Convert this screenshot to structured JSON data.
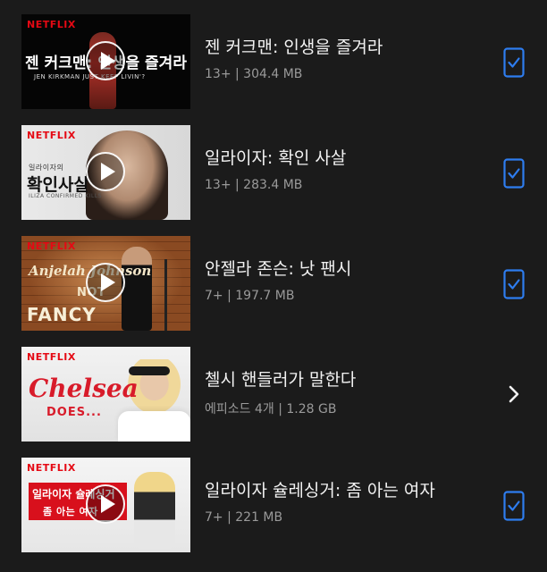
{
  "colors": {
    "background": "#1b1b1b",
    "netflix_red": "#e50914",
    "check_blue": "#2e7df0",
    "meta_gray": "#9a9a9a"
  },
  "downloads": [
    {
      "title": "젠 커크맨: 인생을 즐겨라",
      "meta": "13+ | 304.4 MB",
      "action_icon": "download-complete-check-icon",
      "art": {
        "logo": "NETFLIX",
        "title_text": "젠 커크맨: 인생을 즐겨라",
        "subtitle_text": "JEN KIRKMAN   JUST KEEP LIVIN'?"
      }
    },
    {
      "title": "일라이자: 확인 사살",
      "meta": "13+ | 283.4 MB",
      "action_icon": "download-complete-check-icon",
      "art": {
        "logo": "NETFLIX",
        "title_text": "확인사살",
        "small_text": "일라이자의",
        "subtitle_text": "ILIZA CONFIRMED KILLS"
      }
    },
    {
      "title": "안젤라 존슨: 낫 팬시",
      "meta": "7+ | 197.7 MB",
      "action_icon": "download-complete-check-icon",
      "art": {
        "logo": "NETFLIX",
        "title_text": "Anjelah Johnson",
        "subtitle_text": "FANCY",
        "small_text": "NOT"
      }
    },
    {
      "title": "첼시 핸들러가 말한다",
      "meta": "에피소드 4개 | 1.28 GB",
      "action_icon": "chevron-right-icon",
      "art": {
        "logo": "NETFLIX",
        "title_text": "Chelsea",
        "subtitle_text": "DOES..."
      }
    },
    {
      "title": "일라이자 슐레싱거: 좀 아는 여자",
      "meta": "7+ | 221 MB",
      "action_icon": "download-complete-check-icon",
      "art": {
        "logo": "NETFLIX",
        "title_text": "일라이자 슐레싱거",
        "subtitle_text": "좀 아는 여자"
      }
    }
  ]
}
